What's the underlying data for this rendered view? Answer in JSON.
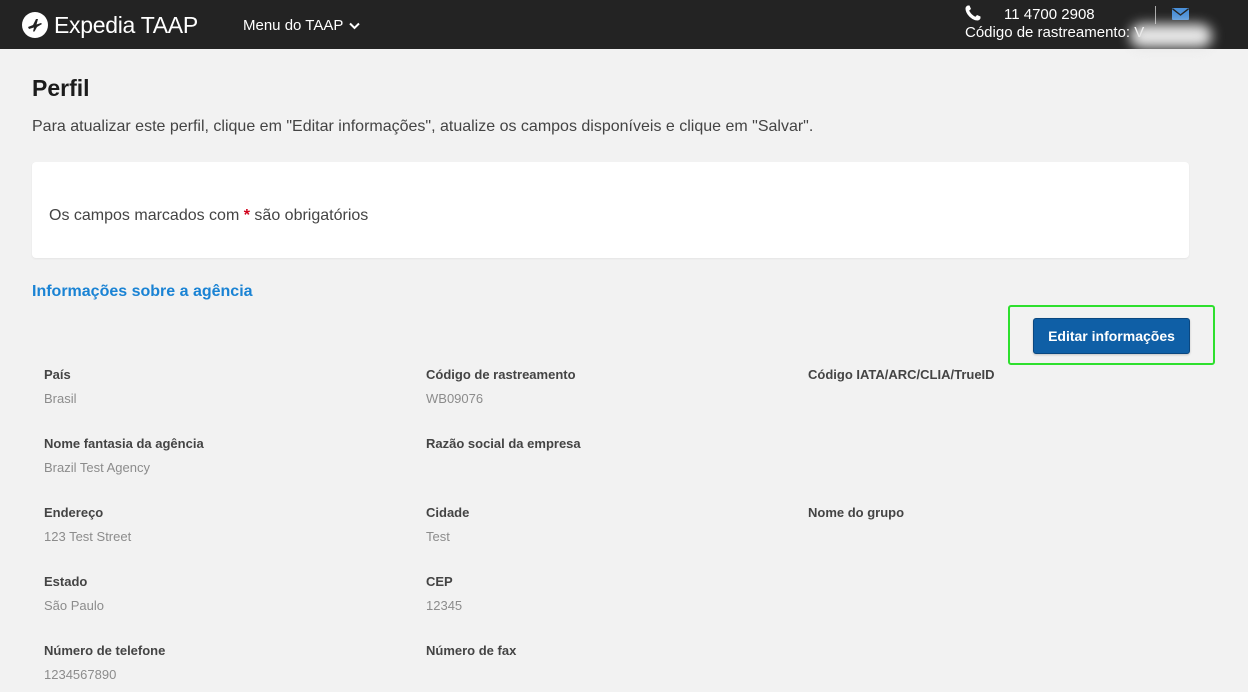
{
  "header": {
    "brand": "Expedia TAAP",
    "menu_label": "Menu do TAAP",
    "phone": "11 4700 2908",
    "tracking_label": "Código de rastreamento: V"
  },
  "page": {
    "title": "Perfil",
    "intro": "Para atualizar este perfil, clique em \"Editar informações\", atualize os campos disponíveis e clique em \"Salvar\".",
    "required_note_before": "Os campos marcados com",
    "required_star": "*",
    "required_note_after": "são obrigatórios",
    "section_title": "Informações sobre a agência",
    "edit_button": "Editar informações"
  },
  "fields": {
    "pais": {
      "label": "País",
      "value": "Brasil"
    },
    "codigo_rastreamento": {
      "label": "Código de rastreamento",
      "value": "WB09076"
    },
    "codigo_iata": {
      "label": "Código IATA/ARC/CLIA/TrueID",
      "value": ""
    },
    "nome_fantasia": {
      "label": "Nome fantasia da agência",
      "value": "Brazil Test Agency"
    },
    "razao_social": {
      "label": "Razão social da empresa",
      "value": ""
    },
    "endereco": {
      "label": "Endereço",
      "value": "123 Test Street"
    },
    "cidade": {
      "label": "Cidade",
      "value": "Test"
    },
    "nome_grupo": {
      "label": "Nome do grupo",
      "value": ""
    },
    "estado": {
      "label": "Estado",
      "value": "São Paulo"
    },
    "cep": {
      "label": "CEP",
      "value": "12345"
    },
    "telefone": {
      "label": "Número de telefone",
      "value": "1234567890"
    },
    "fax": {
      "label": "Número de fax",
      "value": ""
    }
  },
  "colors": {
    "header_bg": "#232323",
    "accent_link": "#1a83d4",
    "button_bg": "#0f5fa6",
    "highlight": "#2ee02e",
    "required": "#d0021b"
  }
}
